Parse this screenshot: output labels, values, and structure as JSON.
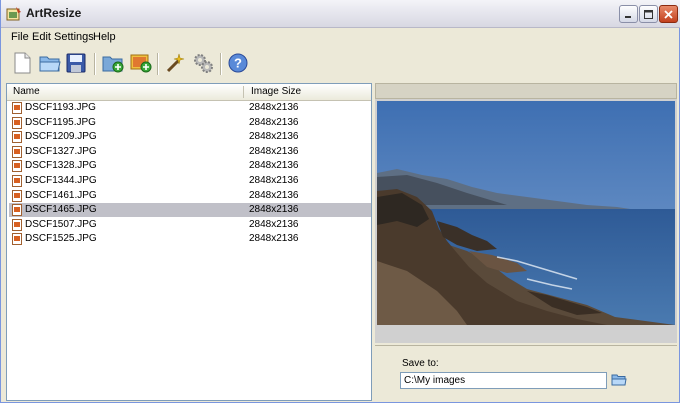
{
  "window": {
    "title": "ArtResize"
  },
  "menu": [
    {
      "label": "File"
    },
    {
      "label": "Edit"
    },
    {
      "label": "Settings"
    },
    {
      "label": "Help"
    }
  ],
  "toolbar": {
    "icons": [
      "new-file-icon",
      "open-folder-icon",
      "save-icon",
      "add-folder-icon",
      "add-image-icon",
      "magic-wand-icon",
      "settings-gears-icon",
      "help-icon"
    ]
  },
  "list": {
    "columns": [
      "Name",
      "Image Size"
    ],
    "rows": [
      {
        "name": "DSCF1193.JPG",
        "size": "2848x2136"
      },
      {
        "name": "DSCF1195.JPG",
        "size": "2848x2136"
      },
      {
        "name": "DSCF1209.JPG",
        "size": "2848x2136"
      },
      {
        "name": "DSCF1327.JPG",
        "size": "2848x2136"
      },
      {
        "name": "DSCF1328.JPG",
        "size": "2848x2136"
      },
      {
        "name": "DSCF1344.JPG",
        "size": "2848x2136"
      },
      {
        "name": "DSCF1461.JPG",
        "size": "2848x2136"
      },
      {
        "name": "DSCF1465.JPG",
        "size": "2848x2136",
        "selected": true
      },
      {
        "name": "DSCF1507.JPG",
        "size": "2848x2136"
      },
      {
        "name": "DSCF1525.JPG",
        "size": "2848x2136"
      }
    ]
  },
  "save": {
    "label": "Save to:",
    "value": "C:\\My images"
  },
  "colors": {
    "selection": "#c0c0c8",
    "accent": "#7f9db9"
  }
}
